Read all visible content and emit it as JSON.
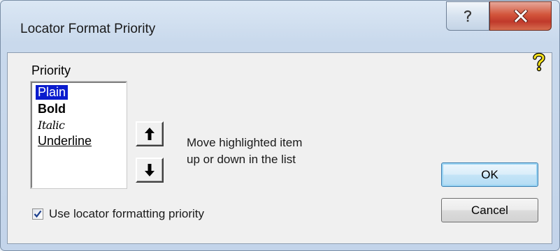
{
  "window": {
    "title": "Locator Format Priority",
    "help_button": "help-icon",
    "close_button": "close-icon",
    "corner_help_icon": "question-mark-icon"
  },
  "priority": {
    "label": "Priority",
    "items": [
      {
        "label": "Plain",
        "selected": true
      },
      {
        "label": "Bold"
      },
      {
        "label": "Italic"
      },
      {
        "label": "Underline"
      }
    ]
  },
  "move": {
    "up_icon": "arrow-up-icon",
    "down_icon": "arrow-down-icon",
    "line1": "Move highlighted item",
    "line2": "up or down in the list"
  },
  "buttons": {
    "ok": "OK",
    "cancel": "Cancel"
  },
  "option": {
    "checked": true,
    "label": "Use locator formatting priority"
  },
  "colors": {
    "selection": "#0a1cce",
    "close_button": "#c0392b",
    "default_button_border": "#3c7fb1"
  }
}
